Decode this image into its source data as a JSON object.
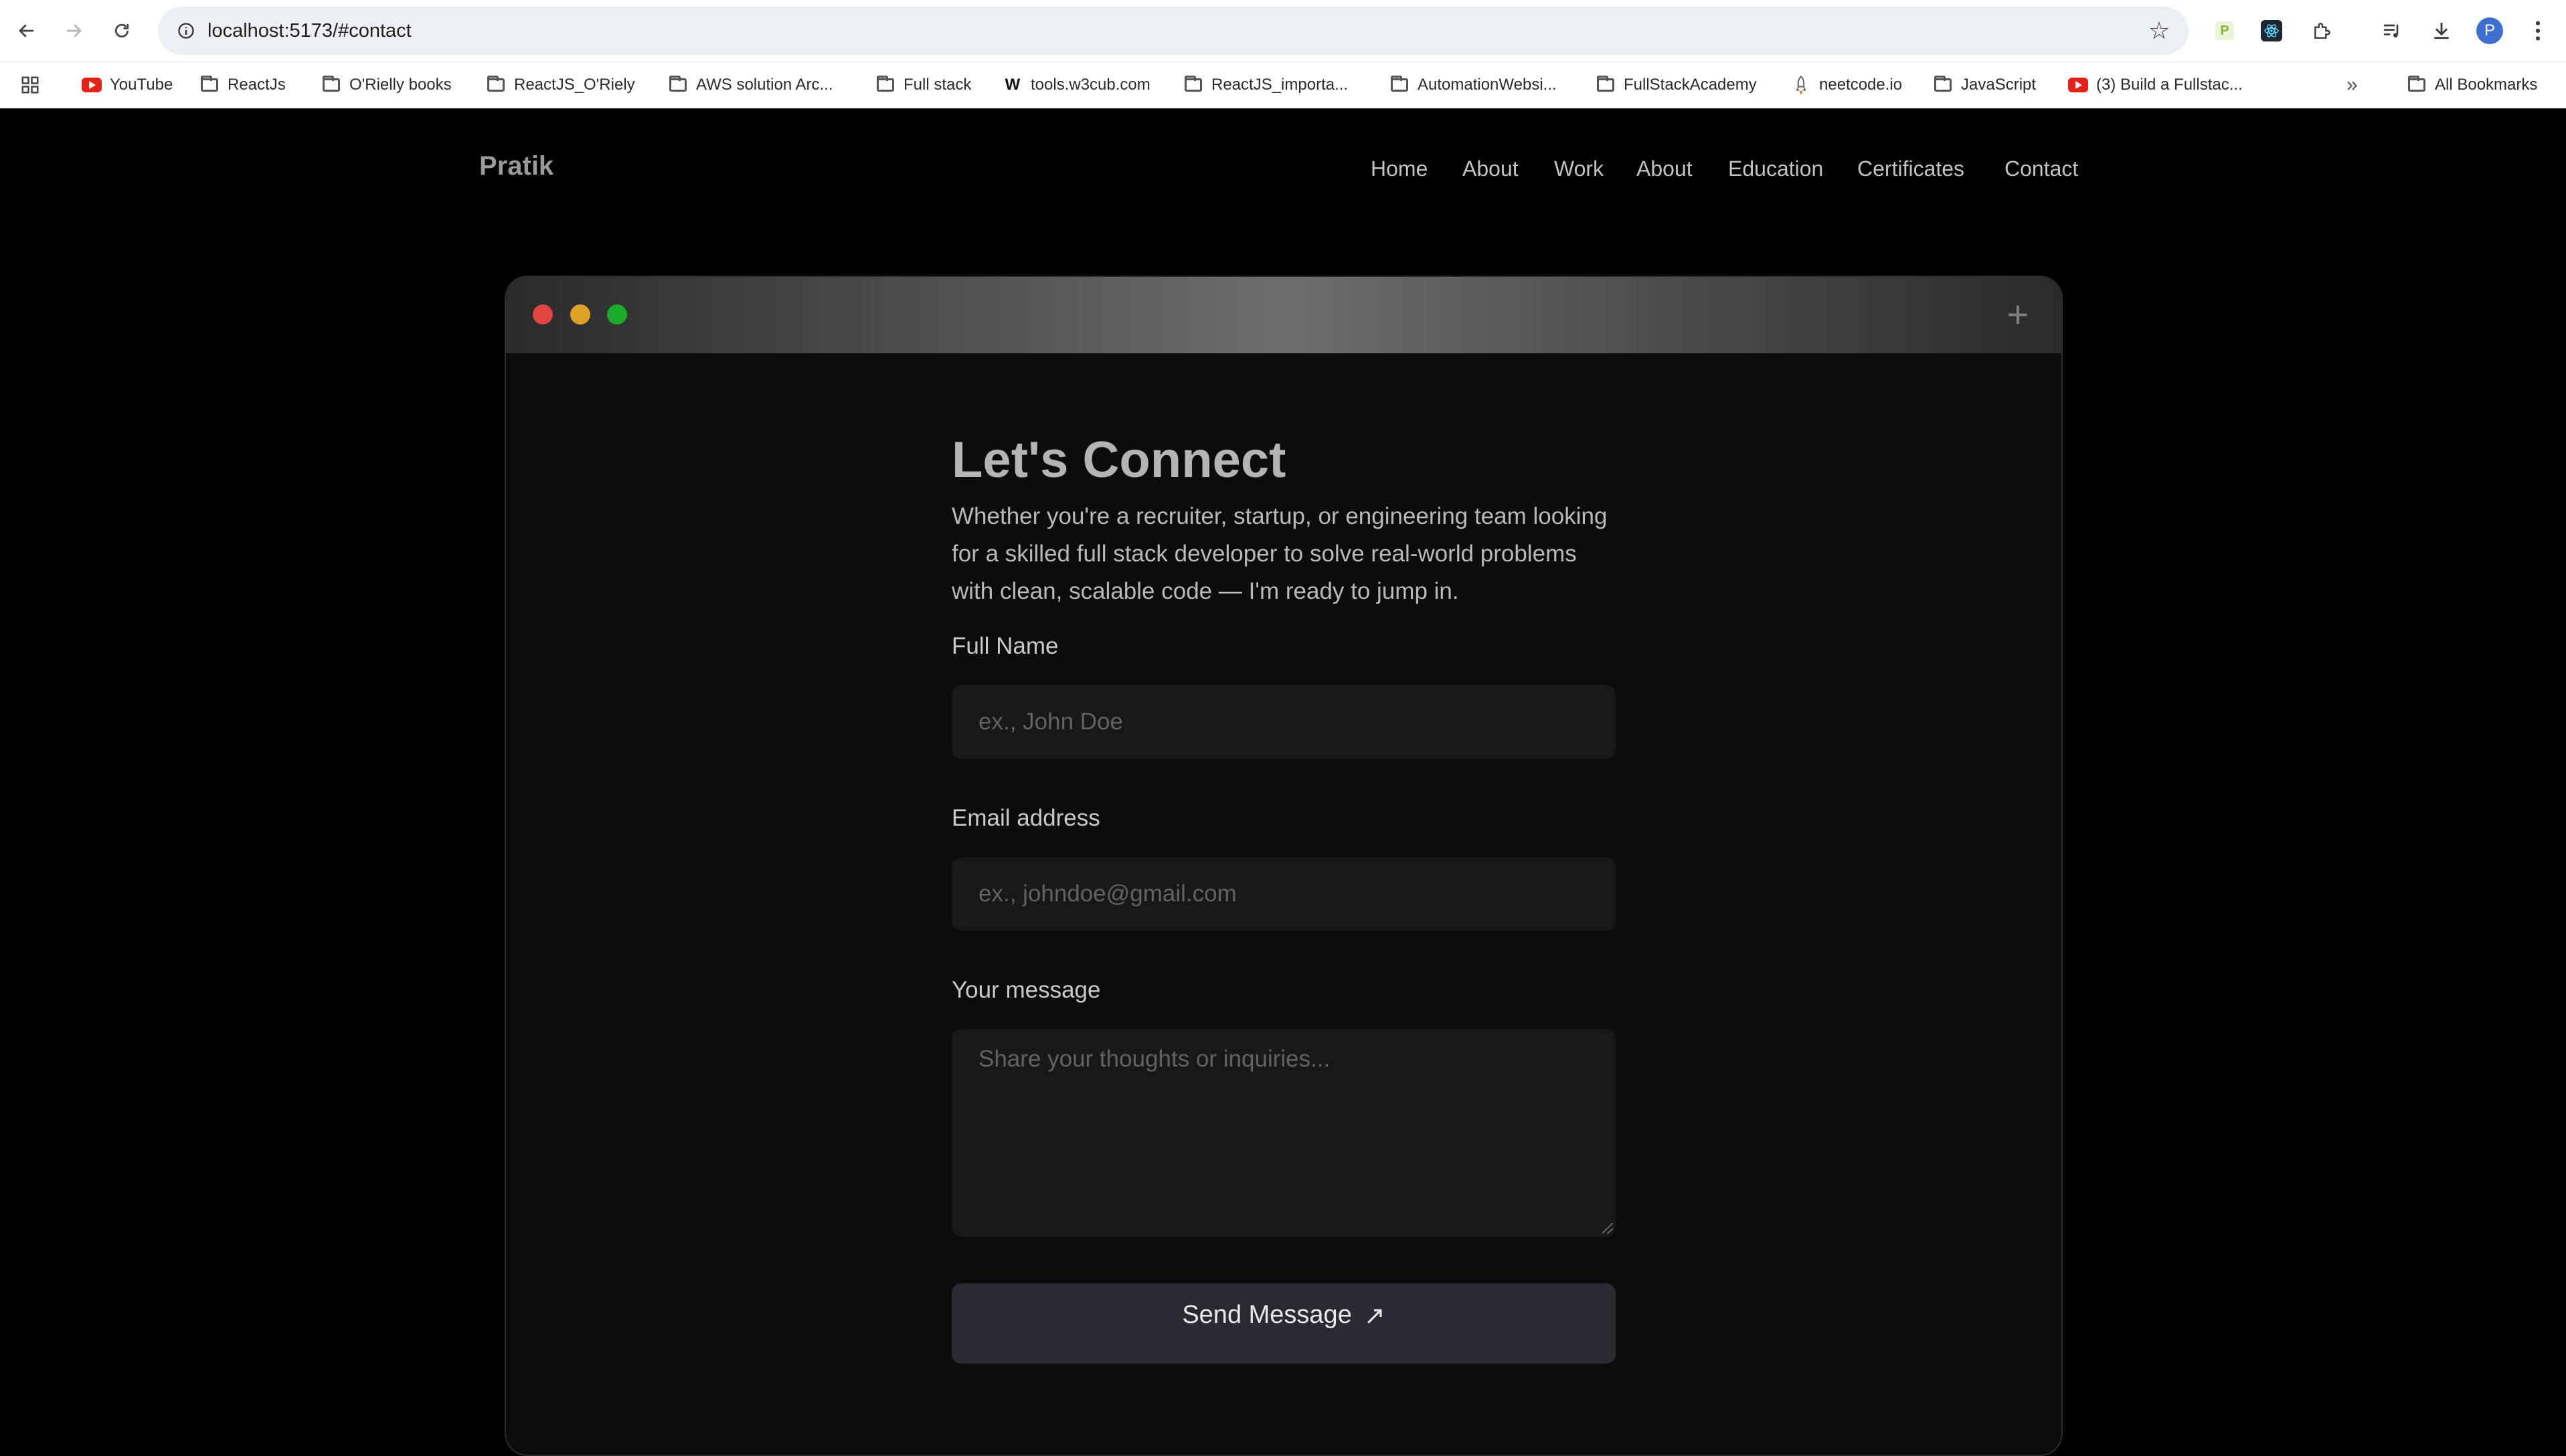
{
  "browser": {
    "url": "localhost:5173/#contact",
    "avatar_letter": "P",
    "bookmarks": [
      {
        "label": "YouTube",
        "icon": "youtube-icon"
      },
      {
        "label": "ReactJs",
        "icon": "folder-icon"
      },
      {
        "label": "O'Rielly books",
        "icon": "folder-icon"
      },
      {
        "label": "ReactJS_O'Riely",
        "icon": "folder-icon"
      },
      {
        "label": "AWS solution Arc...",
        "icon": "folder-icon"
      },
      {
        "label": "Full stack",
        "icon": "folder-icon"
      },
      {
        "label": "tools.w3cub.com",
        "icon": "w-icon"
      },
      {
        "label": "ReactJS_importa...",
        "icon": "folder-icon"
      },
      {
        "label": "AutomationWebsi...",
        "icon": "folder-icon"
      },
      {
        "label": "FullStackAcademy",
        "icon": "folder-icon"
      },
      {
        "label": "neetcode.io",
        "icon": "rocket-icon"
      },
      {
        "label": "JavaScript",
        "icon": "folder-icon"
      },
      {
        "label": "(3) Build a Fullstac...",
        "icon": "youtube-icon"
      }
    ],
    "all_bookmarks": "All Bookmarks",
    "overflow": "»"
  },
  "site": {
    "logo": "Pratik",
    "nav": [
      "Home",
      "About",
      "Work",
      "About",
      "Education",
      "Certificates",
      "Contact"
    ]
  },
  "contact": {
    "heading": "Let's Connect",
    "intro": "Whether you're a recruiter, startup, or engineering team looking for a skilled full stack developer to solve real-world problems with clean, scalable code — I'm ready to jump in.",
    "name_label": "Full Name",
    "name_placeholder": "ex., John Doe",
    "email_label": "Email address",
    "email_placeholder": "ex., johndoe@gmail.com",
    "message_label": "Your message",
    "message_placeholder": "Share your thoughts or inquiries...",
    "send_label": "Send Message",
    "send_arrow": "↗"
  },
  "colors": {
    "page_bg": "#000000",
    "window_bg": "#0c0c0d",
    "field_bg": "#18181a",
    "button_bg": "#2a2a32",
    "dot_red": "#e0443e",
    "dot_yellow": "#dea123",
    "dot_green": "#1aab29"
  }
}
